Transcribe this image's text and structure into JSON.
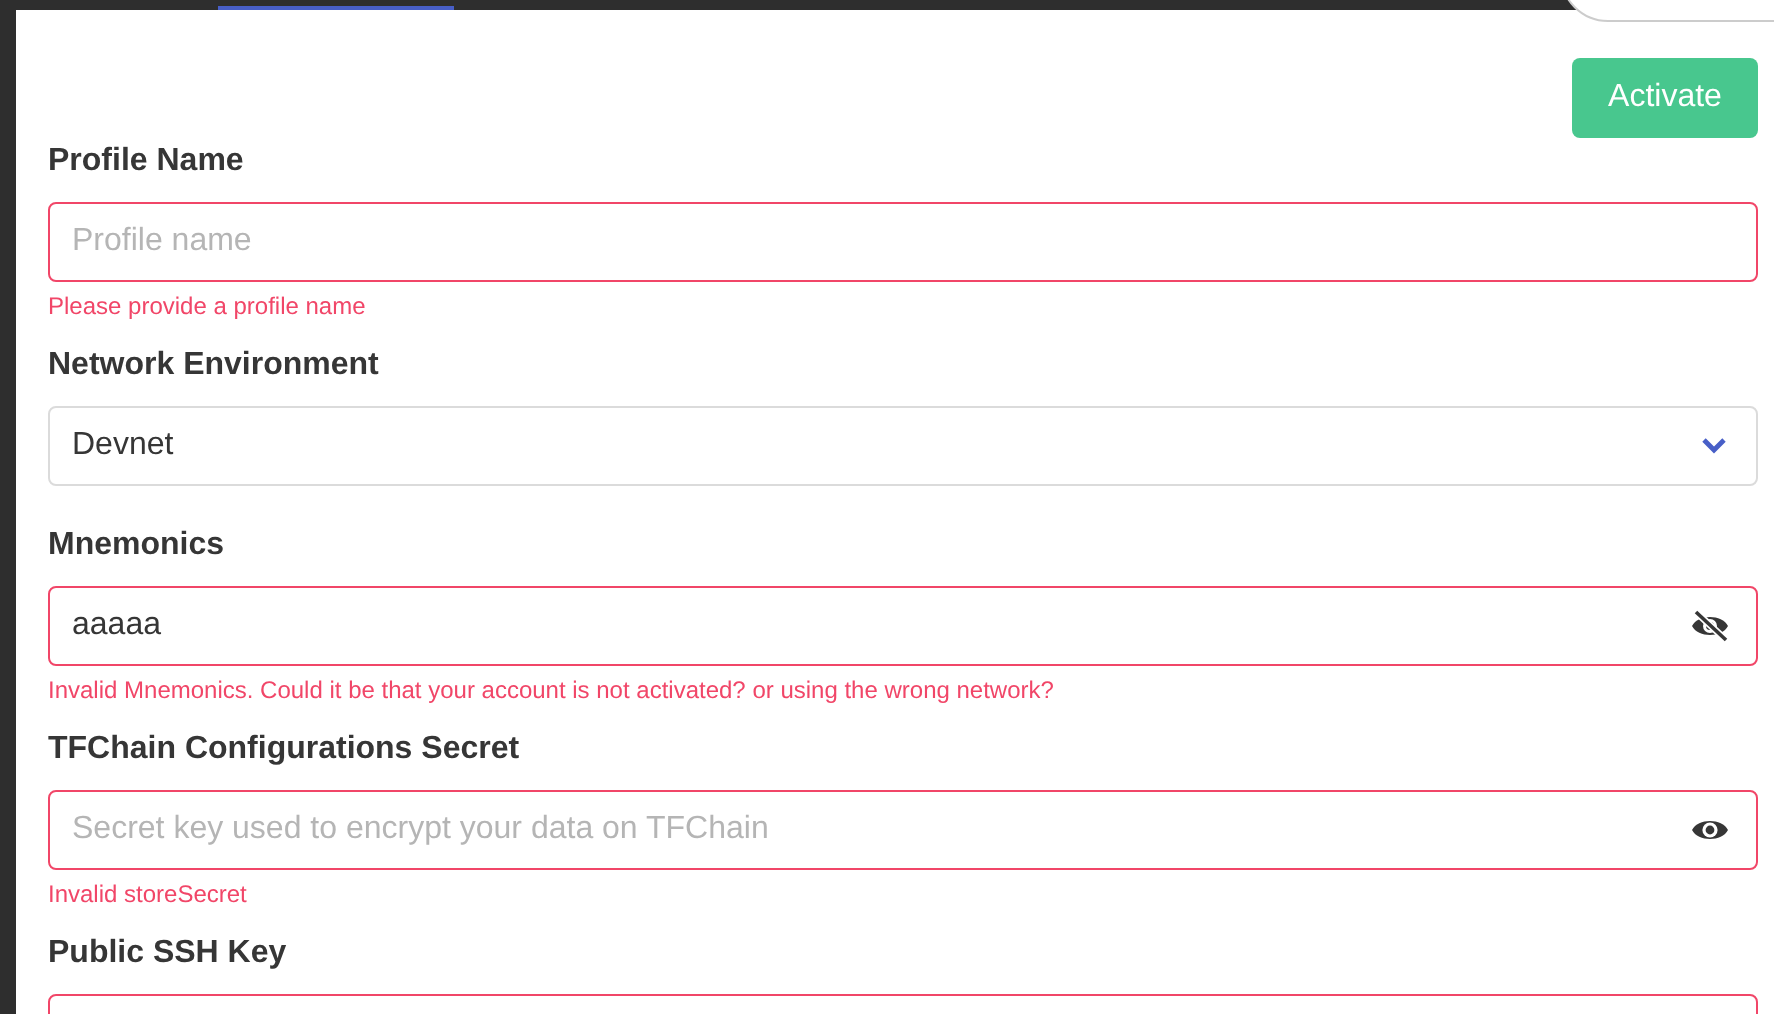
{
  "activate_button": "Activate",
  "fields": [
    {
      "kind": "text",
      "label": "Profile Name",
      "placeholder": "Profile name",
      "invalid": true,
      "error": "Please provide a profile name"
    },
    {
      "kind": "select",
      "label": "Network Environment",
      "value": "Devnet",
      "invalid": false
    },
    {
      "kind": "password",
      "label": "Mnemonics",
      "value": "aaaaa",
      "invalid": true,
      "show_value": true,
      "error": "Invalid Mnemonics. Could it be that your account is not activated? or using the wrong network?"
    },
    {
      "kind": "password",
      "label": "TFChain Configurations Secret",
      "placeholder": "Secret key used to encrypt your data on TFChain",
      "invalid": true,
      "show_value": false,
      "error": "Invalid storeSecret"
    },
    {
      "kind": "text",
      "label": "Public SSH Key",
      "invalid": true
    }
  ]
}
